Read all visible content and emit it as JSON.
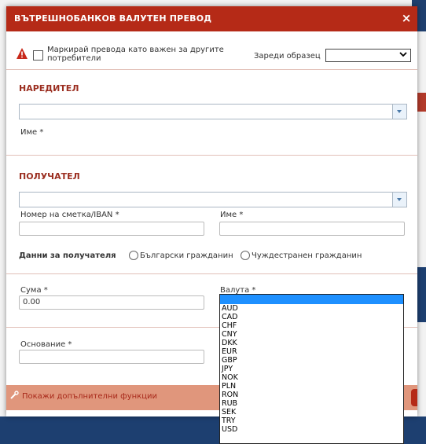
{
  "dialog": {
    "title": "ВЪТРЕШНОБАНКОВ ВАЛУТЕН ПРЕВОД",
    "close_glyph": "×"
  },
  "top": {
    "mark_important_label": "Маркирай превода като важен за другите потребители",
    "load_template_label": "Зареди образец",
    "template_value": ""
  },
  "payer": {
    "section_title": "НАРЕДИТЕЛ",
    "account_value": "",
    "name_label": "Име *"
  },
  "recipient": {
    "section_title": "ПОЛУЧАТЕЛ",
    "account_value": "",
    "iban_label": "Номер на сметка/IBAN *",
    "iban_value": "",
    "name_label": "Име *",
    "name_value": "",
    "data_label": "Данни за получателя",
    "radio_bulgarian": "Български гражданин",
    "radio_foreign": "Чуждестранен гражданин"
  },
  "amount": {
    "amount_label": "Сума *",
    "amount_value": "0.00",
    "currency_label": "Валута *",
    "reason_label": "Основание *",
    "reason_value": ""
  },
  "currency_options": [
    "AUD",
    "CAD",
    "CHF",
    "CNY",
    "DKK",
    "EUR",
    "GBP",
    "JPY",
    "NOK",
    "PLN",
    "RON",
    "RUB",
    "SEK",
    "TRY",
    "USD"
  ],
  "footer": {
    "more_functions_link": "Покажи допълнителни функции"
  },
  "icons": {
    "warning": "warning-triangle-icon",
    "wrench": "wrench-icon",
    "chevron": "chevron-down-icon"
  },
  "colors": {
    "title_bar": "#b52a17",
    "section_title": "#9b2e20",
    "footer_bar": "#e0967c",
    "dropdown_selected": "#1e90ff"
  }
}
